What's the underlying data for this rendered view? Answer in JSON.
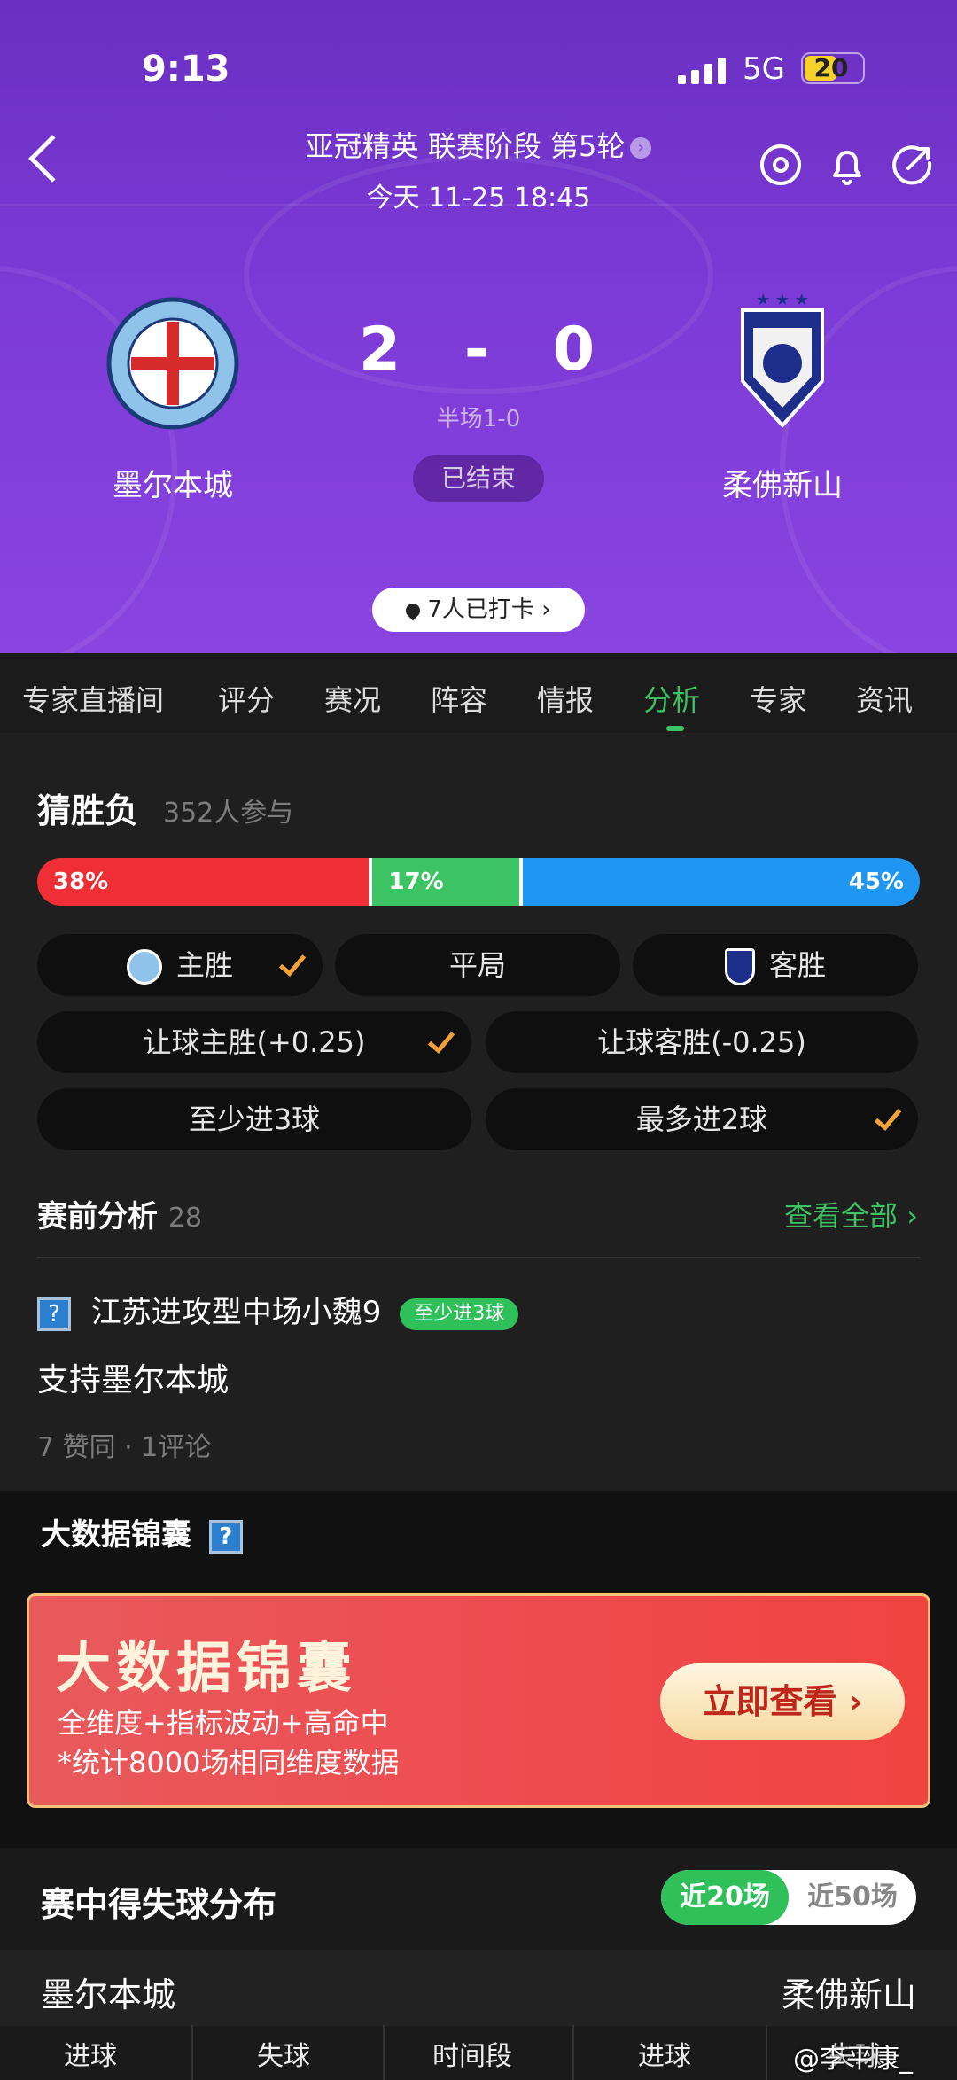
{
  "status_bar": {
    "time": "9:13",
    "network": "5G",
    "battery": "20"
  },
  "header": {
    "competition": "亚冠精英 联赛阶段 第5轮",
    "datetime": "今天 11-25 18:45",
    "home_team": "墨尔本城",
    "away_team": "柔佛新山",
    "score_home": "2",
    "score_sep": "-",
    "score_away": "0",
    "half_time": "半场1-0",
    "status": "已结束",
    "checkin": "7人已打卡"
  },
  "tabs": [
    {
      "label": "专家直播间"
    },
    {
      "label": "评分"
    },
    {
      "label": "赛况"
    },
    {
      "label": "阵容"
    },
    {
      "label": "情报"
    },
    {
      "label": "分析"
    },
    {
      "label": "专家"
    },
    {
      "label": "资讯"
    }
  ],
  "guess": {
    "title": "猜胜负",
    "participants": "352人参与",
    "bar": [
      {
        "label": "38%",
        "value": 38,
        "color": "#ef2e35"
      },
      {
        "label": "17%",
        "value": 17,
        "color": "#3cc464"
      },
      {
        "label": "45%",
        "value": 45,
        "color": "#1f96f1"
      }
    ],
    "options": [
      "主胜",
      "平局",
      "客胜",
      "让球主胜(+0.25)",
      "让球客胜(-0.25)",
      "至少进3球",
      "最多进2球"
    ]
  },
  "pre_analysis": {
    "title": "赛前分析",
    "count": "28",
    "view_all": "查看全部",
    "post": {
      "author": "江苏进攻型中场小魏9",
      "tag": "至少进3球",
      "content": "支持墨尔本城",
      "likes": "7 赞同",
      "comments": "1评论"
    }
  },
  "big_data": {
    "title": "大数据锦囊",
    "banner_title": "大数据锦囊",
    "line1": "全维度+指标波动+高命中",
    "line2": "*统计8000场相同维度数据",
    "button": "立即查看"
  },
  "distribution": {
    "title": "赛中得失球分布",
    "toggle_active": "近20场",
    "toggle_inactive": "近50场",
    "home": "墨尔本城",
    "away": "柔佛新山",
    "headers": [
      "进球",
      "失球",
      "时间段",
      "进球",
      "失球"
    ]
  },
  "watermark": "@李平康_"
}
